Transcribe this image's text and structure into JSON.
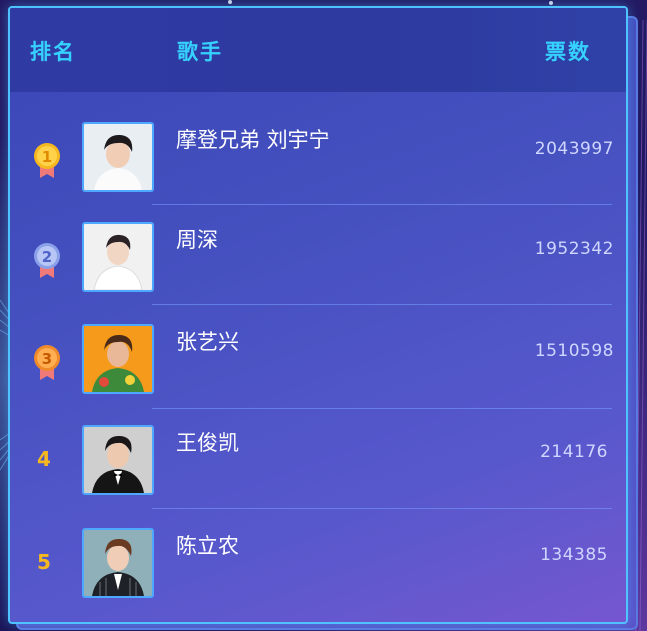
{
  "header": {
    "rank_label": "排名",
    "singer_label": "歌手",
    "votes_label": "票数"
  },
  "rows": [
    {
      "rank": "1",
      "name": "摩登兄弟 刘宇宁",
      "votes": "2043997",
      "medal": "gold"
    },
    {
      "rank": "2",
      "name": "周深",
      "votes": "1952342",
      "medal": "silver"
    },
    {
      "rank": "3",
      "name": "张艺兴",
      "votes": "1510598",
      "medal": "bronze"
    },
    {
      "rank": "4",
      "name": "王俊凯",
      "votes": "214176",
      "medal": "none"
    },
    {
      "rank": "5",
      "name": "陈立农",
      "votes": "134385",
      "medal": "none"
    }
  ],
  "colors": {
    "accent": "#36d2ff",
    "rank_text": "#f6b820",
    "gold_medal": "#f6b820",
    "silver_medal": "#8aa0e8",
    "bronze_medal": "#f08a2a"
  }
}
